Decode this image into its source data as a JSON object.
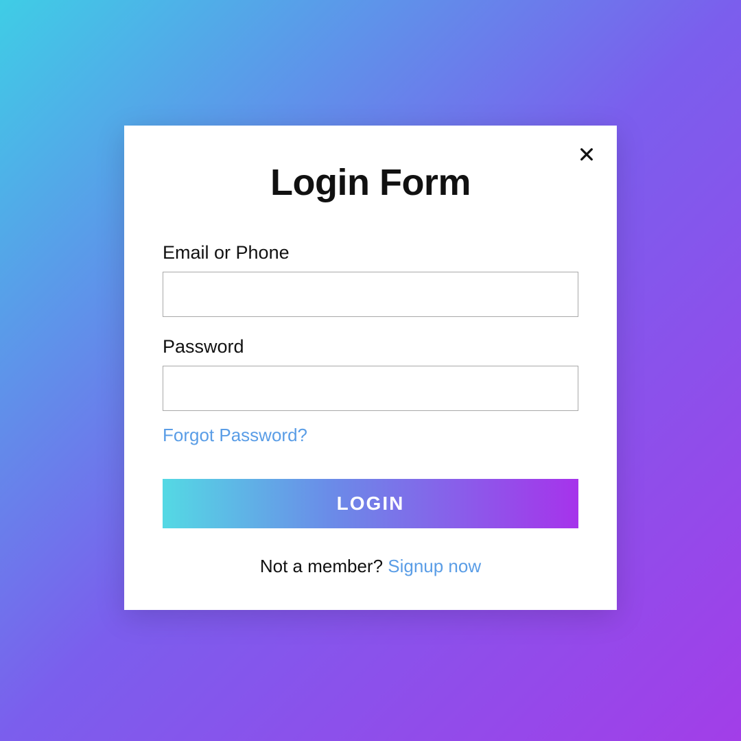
{
  "form": {
    "title": "Login Form",
    "email_label": "Email or Phone",
    "email_value": "",
    "password_label": "Password",
    "password_value": "",
    "forgot_link": "Forgot Password?",
    "login_button": "LOGIN",
    "footer_text": "Not a member? ",
    "signup_link": "Signup now"
  },
  "colors": {
    "bg_gradient_start": "#3fcde6",
    "bg_gradient_mid": "#7b5eed",
    "bg_gradient_end": "#a23ee8",
    "button_gradient_start": "#54d9e4",
    "button_gradient_end": "#a633eb",
    "link_color": "#5a9de6"
  }
}
